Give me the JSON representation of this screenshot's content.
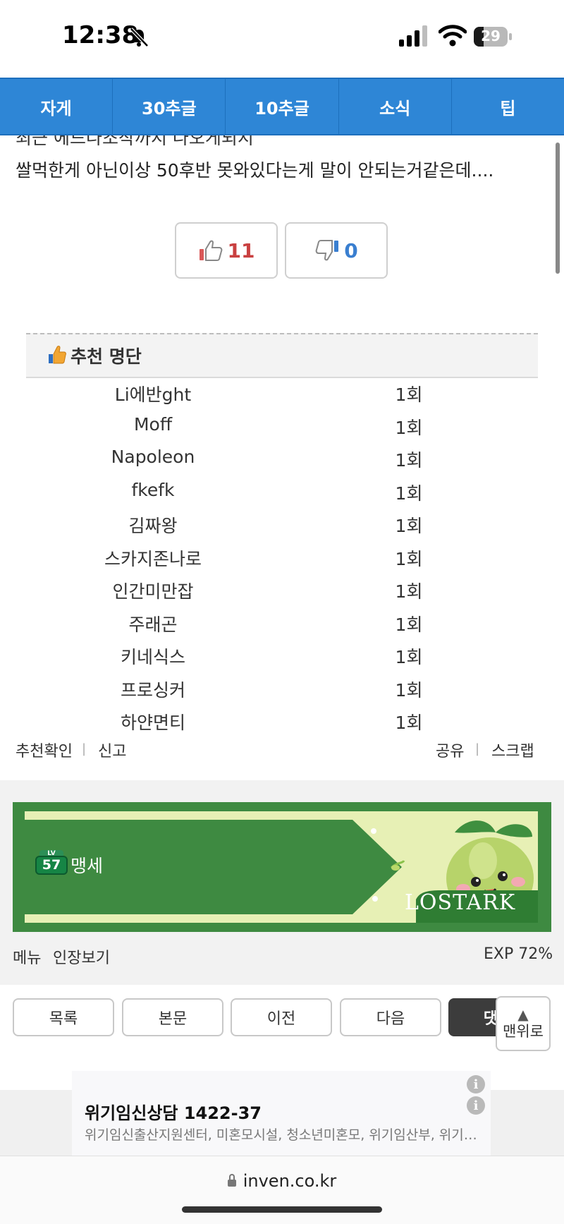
{
  "status": {
    "time": "12:38",
    "battery": "29",
    "battery_level": 0.29
  },
  "tabs": [
    "자게",
    "30추글",
    "10추글",
    "소식",
    "팁"
  ],
  "article": {
    "cut_line": "최근 에드나조작까지 나오게되지",
    "body_line": "쌀먹한게 아닌이상 50후반 못와있다는게 말이 안되는거같은데...."
  },
  "votes": {
    "up": "11",
    "down": "0"
  },
  "recommend": {
    "title": "추천 명단",
    "rows": [
      {
        "name": "Li에반ght",
        "count": "1회"
      },
      {
        "name": "Moff",
        "count": "1회"
      },
      {
        "name": "Napoleon",
        "count": "1회"
      },
      {
        "name": "fkefk",
        "count": "1회"
      },
      {
        "name": "김짜왕",
        "count": "1회"
      },
      {
        "name": "스카지존나로",
        "count": "1회"
      },
      {
        "name": "인간미만잡",
        "count": "1회"
      },
      {
        "name": "주래곤",
        "count": "1회"
      },
      {
        "name": "키네식스",
        "count": "1회"
      },
      {
        "name": "프로싱커",
        "count": "1회"
      },
      {
        "name": "하얀면티",
        "count": "1회"
      }
    ]
  },
  "links": {
    "rec_check": "추천확인",
    "report": "신고",
    "share": "공유",
    "scrap": "스크랩"
  },
  "profile": {
    "level": "57",
    "lv_tag": "LV",
    "name": "맹세",
    "logo": "LOSTARK"
  },
  "menu": {
    "menu": "메뉴",
    "view_sign": "인장보기",
    "exp": "EXP 72%"
  },
  "nav": {
    "list": "목록",
    "body": "본문",
    "prev": "이전",
    "next": "다음",
    "comment": "댓글",
    "top": "맨위로",
    "top_arrow": "▲"
  },
  "ad": {
    "title": "위기임신상담 1422-37",
    "subtitle": "위기임신출산지원센터, 미혼모시설, 청소년미혼모, 위기임산부, 위기…"
  },
  "browser": {
    "url": "inven.co.kr"
  },
  "colors": {
    "tab_blue": "#2e86d6",
    "up_red": "#c94040",
    "down_blue": "#3a7fd0",
    "banner_green": "#3e8a41"
  }
}
